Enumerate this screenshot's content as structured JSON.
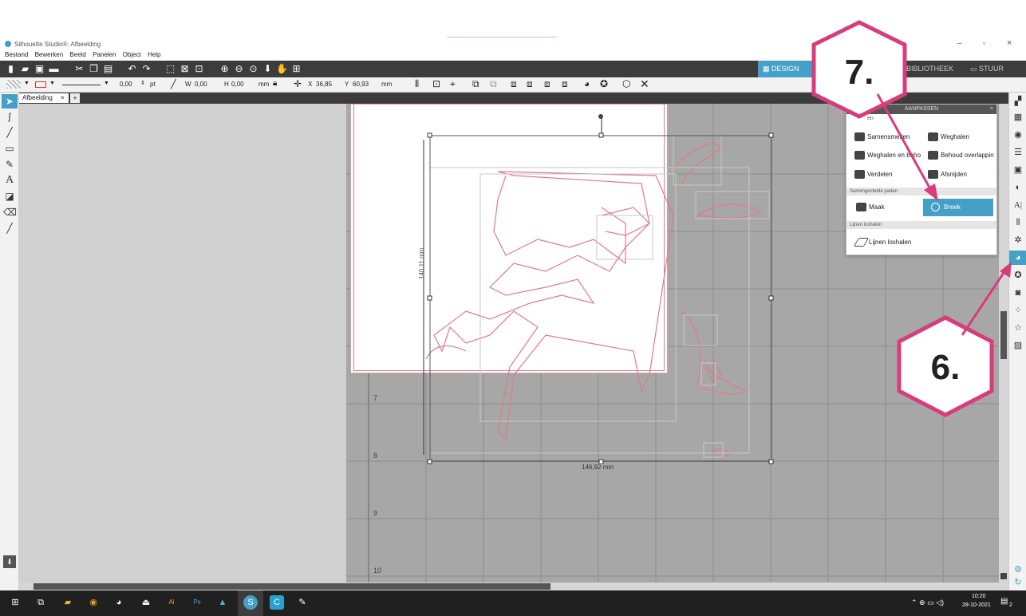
{
  "window": {
    "title": "Silhouette Studio®: Afbeelding"
  },
  "menu": [
    "Bestand",
    "Bewerken",
    "Beeld",
    "Panelen",
    "Object",
    "Help"
  ],
  "top_tabs": {
    "design": "DESIGN",
    "library": "BIBLIOTHEEK",
    "send": "STUUR"
  },
  "toolbar2": {
    "stroke_width": "0,00",
    "stroke_unit": "pt",
    "w_label": "W",
    "w_value": "0,00",
    "h_label": "H",
    "h_value": "0,00",
    "h_unit": "mm",
    "x_label": "X",
    "x_value": "36,85",
    "y_label": "Y",
    "y_value": "60,93",
    "y_unit": "mm"
  },
  "doc_tab": {
    "label": "Afbeelding",
    "close": "×",
    "add": "+"
  },
  "canvas": {
    "height_label": "140,11 mm",
    "width_label": "146,92 mm",
    "ruler": [
      "7",
      "8",
      "9",
      "10"
    ]
  },
  "panel": {
    "title": "AANPASSEN",
    "close": "×",
    "top_label": "en",
    "buttons": [
      {
        "label": "Samensmelten"
      },
      {
        "label": "Weghalen"
      },
      {
        "label": "Weghalen en beho"
      },
      {
        "label": "Behoud overlappin"
      },
      {
        "label": "Verdelen"
      },
      {
        "label": "Afsnijden"
      }
    ],
    "section_compound": "Samengestelde paden",
    "make": "Maak",
    "break": "Breek",
    "section_lines": "Lijnen loshalen",
    "release": "Lijnen loshalen"
  },
  "callouts": {
    "seven": "7.",
    "six": "6."
  },
  "taskbar": {
    "time": "10:20",
    "date": "28-10-2021",
    "notif": "2"
  },
  "colors": {
    "accent": "#45a0c8",
    "callout": "#d83c7c",
    "cut_line": "#e07a8a"
  }
}
